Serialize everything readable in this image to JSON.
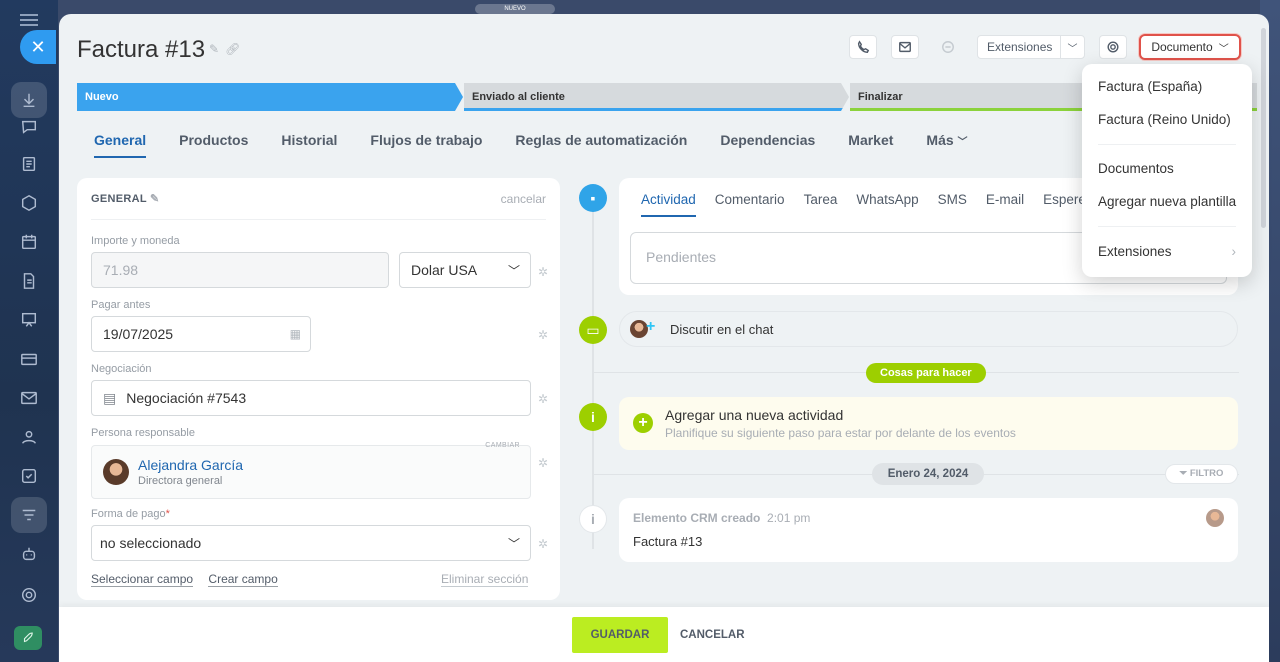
{
  "top_badge": "NUEVO",
  "header": {
    "title": "Factura #13",
    "extensions_label": "Extensiones",
    "document_label": "Documento"
  },
  "stages": [
    "Nuevo",
    "Enviado al cliente",
    "Finalizar"
  ],
  "tabs": [
    "General",
    "Productos",
    "Historial",
    "Flujos de trabajo",
    "Reglas de automatización",
    "Dependencias",
    "Market",
    "Más"
  ],
  "form": {
    "section_title": "GENERAL",
    "cancel_label": "cancelar",
    "amount_label": "Importe y moneda",
    "amount_value": "71.98",
    "currency_value": "Dolar USA",
    "pay_before_label": "Pagar antes",
    "pay_before_value": "19/07/2025",
    "deal_label": "Negociación",
    "deal_value": "Negociación #7543",
    "responsible_label": "Persona responsable",
    "change_label": "CAMBIAR",
    "responsible_name": "Alejandra García",
    "responsible_role": "Directora general",
    "payment_label": "Forma de pago",
    "payment_value": "no seleccionado",
    "select_field": "Seleccionar campo",
    "create_field": "Crear campo",
    "delete_section": "Eliminar sección"
  },
  "activity": {
    "tabs": [
      "Actividad",
      "Comentario",
      "Tarea",
      "WhatsApp",
      "SMS",
      "E-mail",
      "Espere"
    ],
    "pending_placeholder": "Pendientes",
    "chat_label": "Discutir en el chat",
    "todo_pill": "Cosas para hacer",
    "new_activity_title": "Agregar una nueva actividad",
    "new_activity_sub": "Planifique su siguiente paso para estar por delante de los eventos",
    "date_pill": "Enero 24, 2024",
    "filter_label": "FILTRO",
    "created_title": "Elemento CRM creado",
    "created_time": "2:01 pm",
    "created_body": "Factura #13"
  },
  "footer": {
    "save_label": "GUARDAR",
    "cancel_label": "CANCELAR"
  },
  "dropdown": {
    "items": [
      "Factura (España)",
      "Factura (Reino Unido)",
      "Documentos",
      "Agregar nueva plantilla",
      "Extensiones"
    ]
  },
  "colors": {
    "accent": "#2067b0",
    "stage_active": "#3aa3ee",
    "save_green": "#bbed21",
    "highlight_red": "#e0524a"
  }
}
